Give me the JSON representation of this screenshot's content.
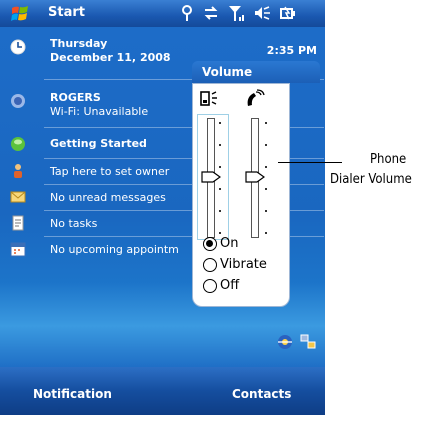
{
  "topbar": {
    "start_label": "Start"
  },
  "today": {
    "date_day": "Thursday",
    "date_full": "December 11, 2008",
    "time": "2:35 PM",
    "carrier": "ROGERS",
    "wifi_status": "Wi-Fi: Unavailable",
    "getting_started": "Getting Started",
    "owner": "Tap here to set owner",
    "messages": "No unread messages",
    "tasks": "No tasks",
    "appointments": "No upcoming appointm"
  },
  "volume_popup": {
    "title": "Volume",
    "system_volume_level": 0.5,
    "phone_volume_level": 0.5,
    "options": [
      "On",
      "Vibrate",
      "Off"
    ],
    "selected_option": "On"
  },
  "softkeys": {
    "left": "Notification",
    "right": "Contacts"
  },
  "callout": {
    "line1": "Phone",
    "line2": "Dialer Volume"
  },
  "icons": [
    "windows-flag-icon",
    "connectivity-icon",
    "sync-icon",
    "signal-icon",
    "speaker-icon",
    "battery-icon",
    "clock-icon",
    "network-icon",
    "getting-started-icon",
    "owner-icon",
    "messages-icon",
    "tasks-icon",
    "calendar-icon",
    "speaker-vibrate-icon",
    "phone-handset-icon",
    "internet-explorer-icon",
    "connection-tray-icon"
  ]
}
